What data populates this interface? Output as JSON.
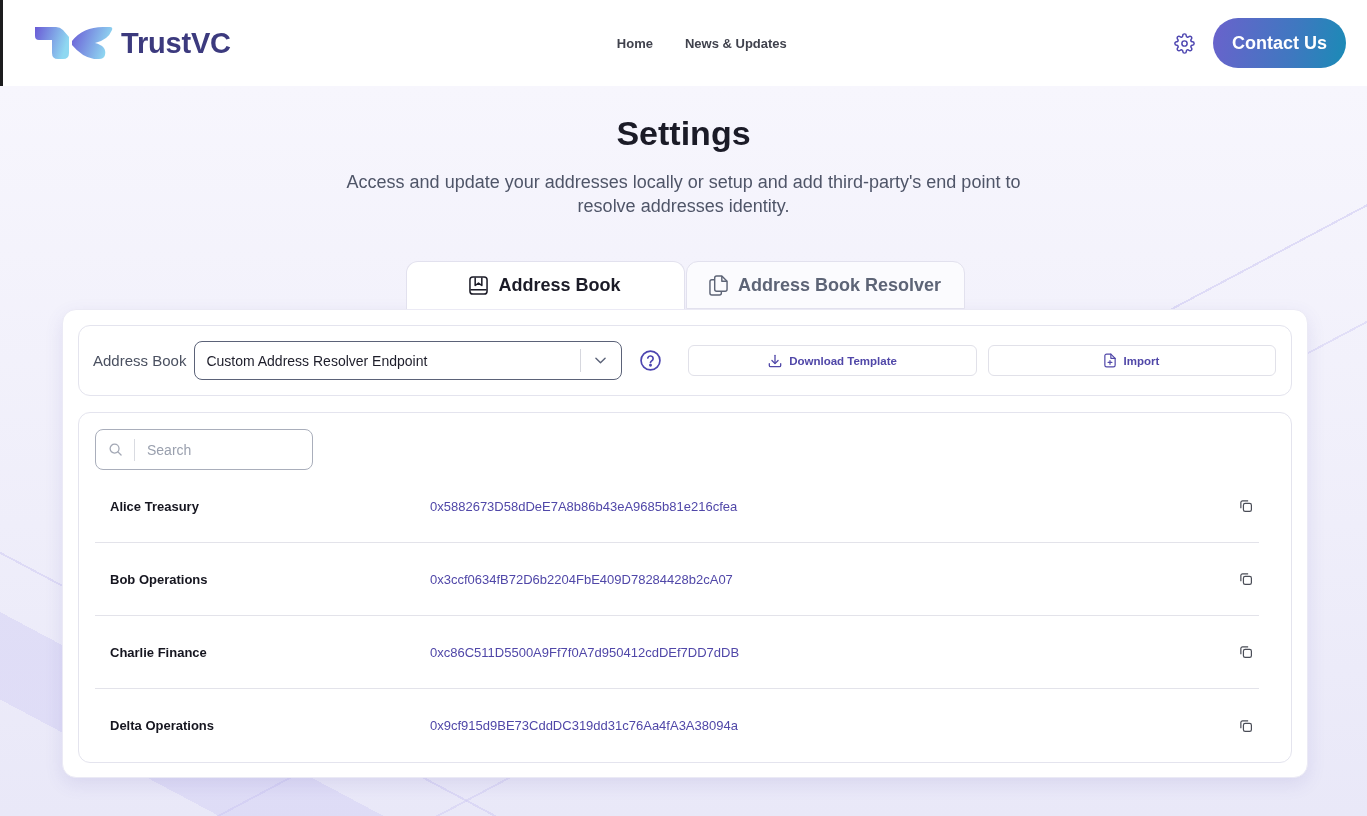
{
  "header": {
    "brand": "TrustVC",
    "nav": [
      {
        "label": "Home"
      },
      {
        "label": "News & Updates"
      }
    ],
    "contact_button": "Contact Us"
  },
  "page": {
    "title": "Settings",
    "description": "Access and update your addresses locally or setup and add third-party's end point to resolve addresses identity."
  },
  "tabs": [
    {
      "label": "Address Book",
      "selected": true
    },
    {
      "label": "Address Book Resolver",
      "selected": false
    }
  ],
  "address_book": {
    "label": "Address Book",
    "selected_book": "Custom Address Resolver Endpoint",
    "buttons": [
      "Download Template",
      "Import"
    ]
  },
  "search": {
    "placeholder": "Search"
  },
  "entries": [
    {
      "name": "Alice Treasury",
      "address": "0x5882673D58dDeE7A8b86b43eA9685b81e216cfea"
    },
    {
      "name": "Bob Operations",
      "address": "0x3ccf0634fB72D6b2204FbE409D78284428b2cA07"
    },
    {
      "name": "Charlie Finance",
      "address": "0xc86C511D5500A9Ff7f0A7d950412cdDEf7DD7dDB"
    },
    {
      "name": "Delta Operations",
      "address": "0x9cf915d9BE73CddDC319dd31c76Aa4fA3A38094a"
    }
  ]
}
